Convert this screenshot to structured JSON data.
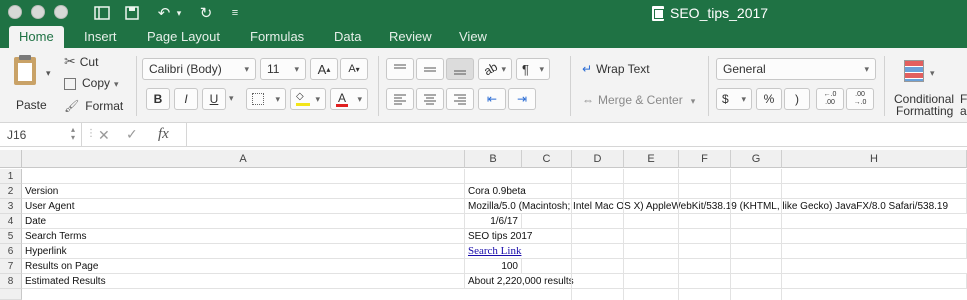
{
  "window": {
    "title": "SEO_tips_2017"
  },
  "tabs": [
    "Home",
    "Insert",
    "Page Layout",
    "Formulas",
    "Data",
    "Review",
    "View"
  ],
  "ribbon": {
    "paste": "Paste",
    "cut": "Cut",
    "copy": "Copy",
    "format": "Format",
    "font_name": "Calibri (Body)",
    "font_size": "11",
    "bold": "B",
    "italic": "I",
    "underline": "U",
    "wrap_text": "Wrap Text",
    "merge_center": "Merge & Center",
    "number_format": "General",
    "currency": "$",
    "percent": "%",
    "comma": ")",
    "inc_decimal_top": "←.0",
    "inc_decimal_bottom": ".00",
    "dec_decimal_top": ".00",
    "dec_decimal_bottom": "→.0",
    "conditional_formatting_1": "Conditional",
    "conditional_formatting_2": "Formatting",
    "cut_off_1": "F",
    "cut_off_2": "as"
  },
  "formula_bar": {
    "cell_ref": "J16",
    "fx": "fx",
    "value": ""
  },
  "sheet": {
    "columns": [
      "A",
      "B",
      "C",
      "D",
      "E",
      "F",
      "G",
      "H"
    ],
    "rows": [
      {
        "n": "1",
        "a": "",
        "b": ""
      },
      {
        "n": "2",
        "a": "Version",
        "b": "Cora 0.9beta"
      },
      {
        "n": "3",
        "a": "User Agent",
        "b": "Mozilla/5.0 (Macintosh; Intel Mac OS X) AppleWebKit/538.19 (KHTML, like Gecko) JavaFX/8.0 Safari/538.19"
      },
      {
        "n": "4",
        "a": "Date",
        "b": "1/6/17"
      },
      {
        "n": "5",
        "a": "Search Terms",
        "b": "SEO tips 2017"
      },
      {
        "n": "6",
        "a": "Hyperlink",
        "b": "Search Link"
      },
      {
        "n": "7",
        "a": "Results on Page",
        "b": "100"
      },
      {
        "n": "8",
        "a": "Estimated Results",
        "b": "About 2,220,000 results"
      }
    ]
  }
}
